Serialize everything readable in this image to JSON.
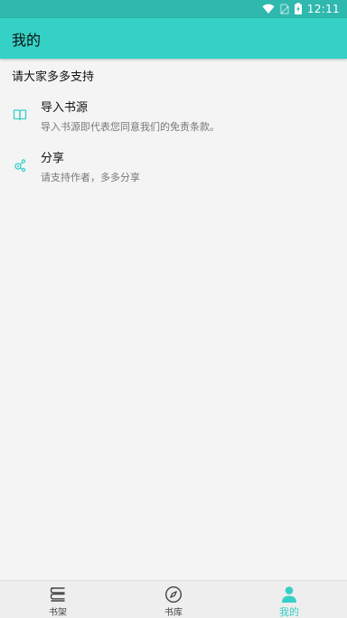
{
  "status_bar": {
    "time": "12:11",
    "icons": [
      "wifi-icon",
      "no-sim-icon",
      "battery-charging-icon"
    ]
  },
  "app_bar": {
    "title": "我的"
  },
  "section": {
    "header": "请大家多多支持"
  },
  "menu": {
    "items": [
      {
        "title": "导入书源",
        "subtitle": "导入书源即代表您同意我们的免责条款。",
        "icon": "open-book-icon"
      },
      {
        "title": "分享",
        "subtitle": "请支持作者，多多分享",
        "icon": "share-icon"
      }
    ]
  },
  "bottom_nav": {
    "tabs": [
      {
        "label": "书架",
        "icon": "bookshelf-icon",
        "active": false
      },
      {
        "label": "书库",
        "icon": "compass-icon",
        "active": false
      },
      {
        "label": "我的",
        "icon": "person-icon",
        "active": true
      }
    ]
  },
  "colors": {
    "accent": "#35d1c6",
    "status_bar": "#2fb8ae",
    "background": "#f4f4f4"
  }
}
